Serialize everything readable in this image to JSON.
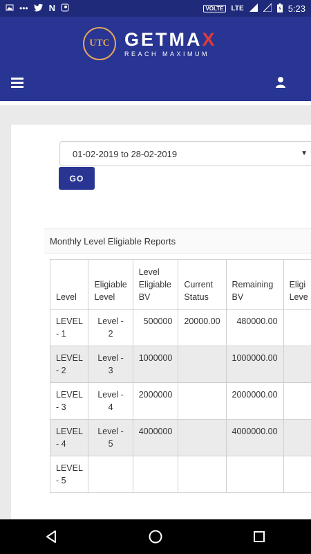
{
  "status_bar": {
    "time": "5:23",
    "volte": "VOLTE",
    "network": "LTE"
  },
  "header": {
    "logo_badge": "UTC",
    "logo_title_main": "GETMA",
    "logo_title_x": "X",
    "logo_tagline": "REACH MAXIMUM"
  },
  "filters": {
    "date_range_value": "01-02-2019 to 28-02-2019",
    "go_label": "GO"
  },
  "report": {
    "title": "Monthly Level Eligiable Reports",
    "columns": [
      "Level",
      "Eligiable Level",
      "Level Eligiable BV",
      "Current Status",
      "Remaining BV",
      "Eligi Leve"
    ],
    "rows": [
      [
        "LEVEL - 1",
        "Level - 2",
        "500000",
        "20000.00",
        "480000.00",
        ""
      ],
      [
        "LEVEL - 2",
        "Level - 3",
        "1000000",
        "",
        "1000000.00",
        ""
      ],
      [
        "LEVEL - 3",
        "Level - 4",
        "2000000",
        "",
        "2000000.00",
        ""
      ],
      [
        "LEVEL - 4",
        "Level - 5",
        "4000000",
        "",
        "4000000.00",
        ""
      ],
      [
        "LEVEL - 5",
        "",
        "",
        "",
        "",
        ""
      ]
    ]
  },
  "icons": {
    "menu": "hamburger-icon",
    "user": "user-icon",
    "back": "back-icon",
    "home": "home-icon",
    "recents": "recents-icon"
  }
}
